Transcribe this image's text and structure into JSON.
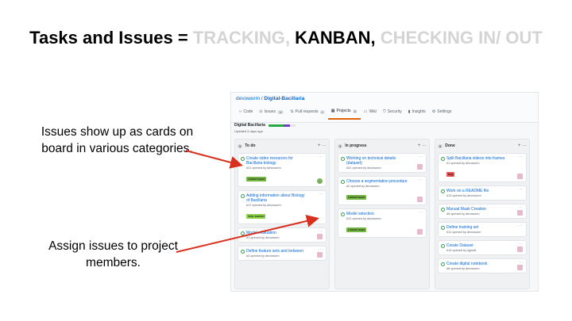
{
  "slide": {
    "title_prefix": "Tasks and Issues = ",
    "title_tracking": "TRACKING, ",
    "title_kanban": "KANBAN, ",
    "title_checking": "CHECKING IN/ OUT",
    "note_1": "Issues show up as cards on board in various categories.",
    "note_2": "Assign issues to project members."
  },
  "repo": {
    "owner": "devoworm",
    "sep": " / ",
    "name": "Digital-Bacillaria"
  },
  "tabs": [
    {
      "label": "Code",
      "count": ""
    },
    {
      "label": "Issues",
      "count": "12"
    },
    {
      "label": "Pull requests",
      "count": "0"
    },
    {
      "label": "Projects",
      "count": "3"
    },
    {
      "label": "Wiki",
      "count": ""
    },
    {
      "label": "Security",
      "count": ""
    },
    {
      "label": "Insights",
      "count": ""
    },
    {
      "label": "Settings",
      "count": ""
    }
  ],
  "project": {
    "name": "Digital Bacillaria",
    "updated": "Updated 5 days ago",
    "progress_done": 0.55,
    "progress_in_progress": 0.25
  },
  "columns": [
    {
      "name": "To do",
      "count": "5",
      "actions": "+ ···",
      "cards": [
        {
          "title": "Create video resources for Bacillaria biology",
          "meta": "#21 opened by devoworm",
          "label": "Linked Issue",
          "label_color": "#74b743"
        },
        {
          "title": "Adding information about Biology of Bacillaria",
          "meta": "#17 opened by devoworm",
          "label": "help wanted",
          "label_color": "#8fd44a"
        },
        {
          "title": "Model evaluation",
          "meta": "#1 opened by devoworm",
          "label": "",
          "label_color": ""
        },
        {
          "title": "Define feature sets and between",
          "meta": "#3 opened by devoworm",
          "label": "",
          "label_color": ""
        }
      ]
    },
    {
      "name": "In progress",
      "count": "3",
      "actions": "+ ···",
      "cards": [
        {
          "title": "Working on technical details (dataset)",
          "meta": "#22 opened by devoworm",
          "label": "",
          "label_color": ""
        },
        {
          "title": "Choose a segmentation procedure",
          "meta": "#2 opened by devoworm",
          "label": "Linked Issue",
          "label_color": "#74b743"
        },
        {
          "title": "Model selection",
          "meta": "#12 opened by devoworm",
          "label": "Linked Issue",
          "label_color": "#74b743"
        }
      ]
    },
    {
      "name": "Done",
      "count": "6",
      "actions": "+ ···",
      "cards": [
        {
          "title": "Split Bacillaria videos into frames",
          "meta": "#1 opened by devoworm",
          "label": "bug",
          "label_color": "#e95454"
        },
        {
          "title": "Work on a README file",
          "meta": "#13 opened by devoworm",
          "label": "",
          "label_color": ""
        },
        {
          "title": "Manual Mask Creation",
          "meta": "#6 opened by devoworm",
          "label": "",
          "label_color": ""
        },
        {
          "title": "Define training set",
          "meta": "#11 opened by devoworm",
          "label": "",
          "label_color": ""
        },
        {
          "title": "Create Dataset",
          "meta": "#14 opened by ujjwal1",
          "label": "",
          "label_color": ""
        },
        {
          "title": "Create digital notebook",
          "meta": "#6 opened by devoworm",
          "label": "",
          "label_color": ""
        }
      ]
    }
  ],
  "colors": {
    "accent_orange": "#e36209",
    "arrow_red": "#d9301e",
    "link_blue": "#0366d6"
  }
}
